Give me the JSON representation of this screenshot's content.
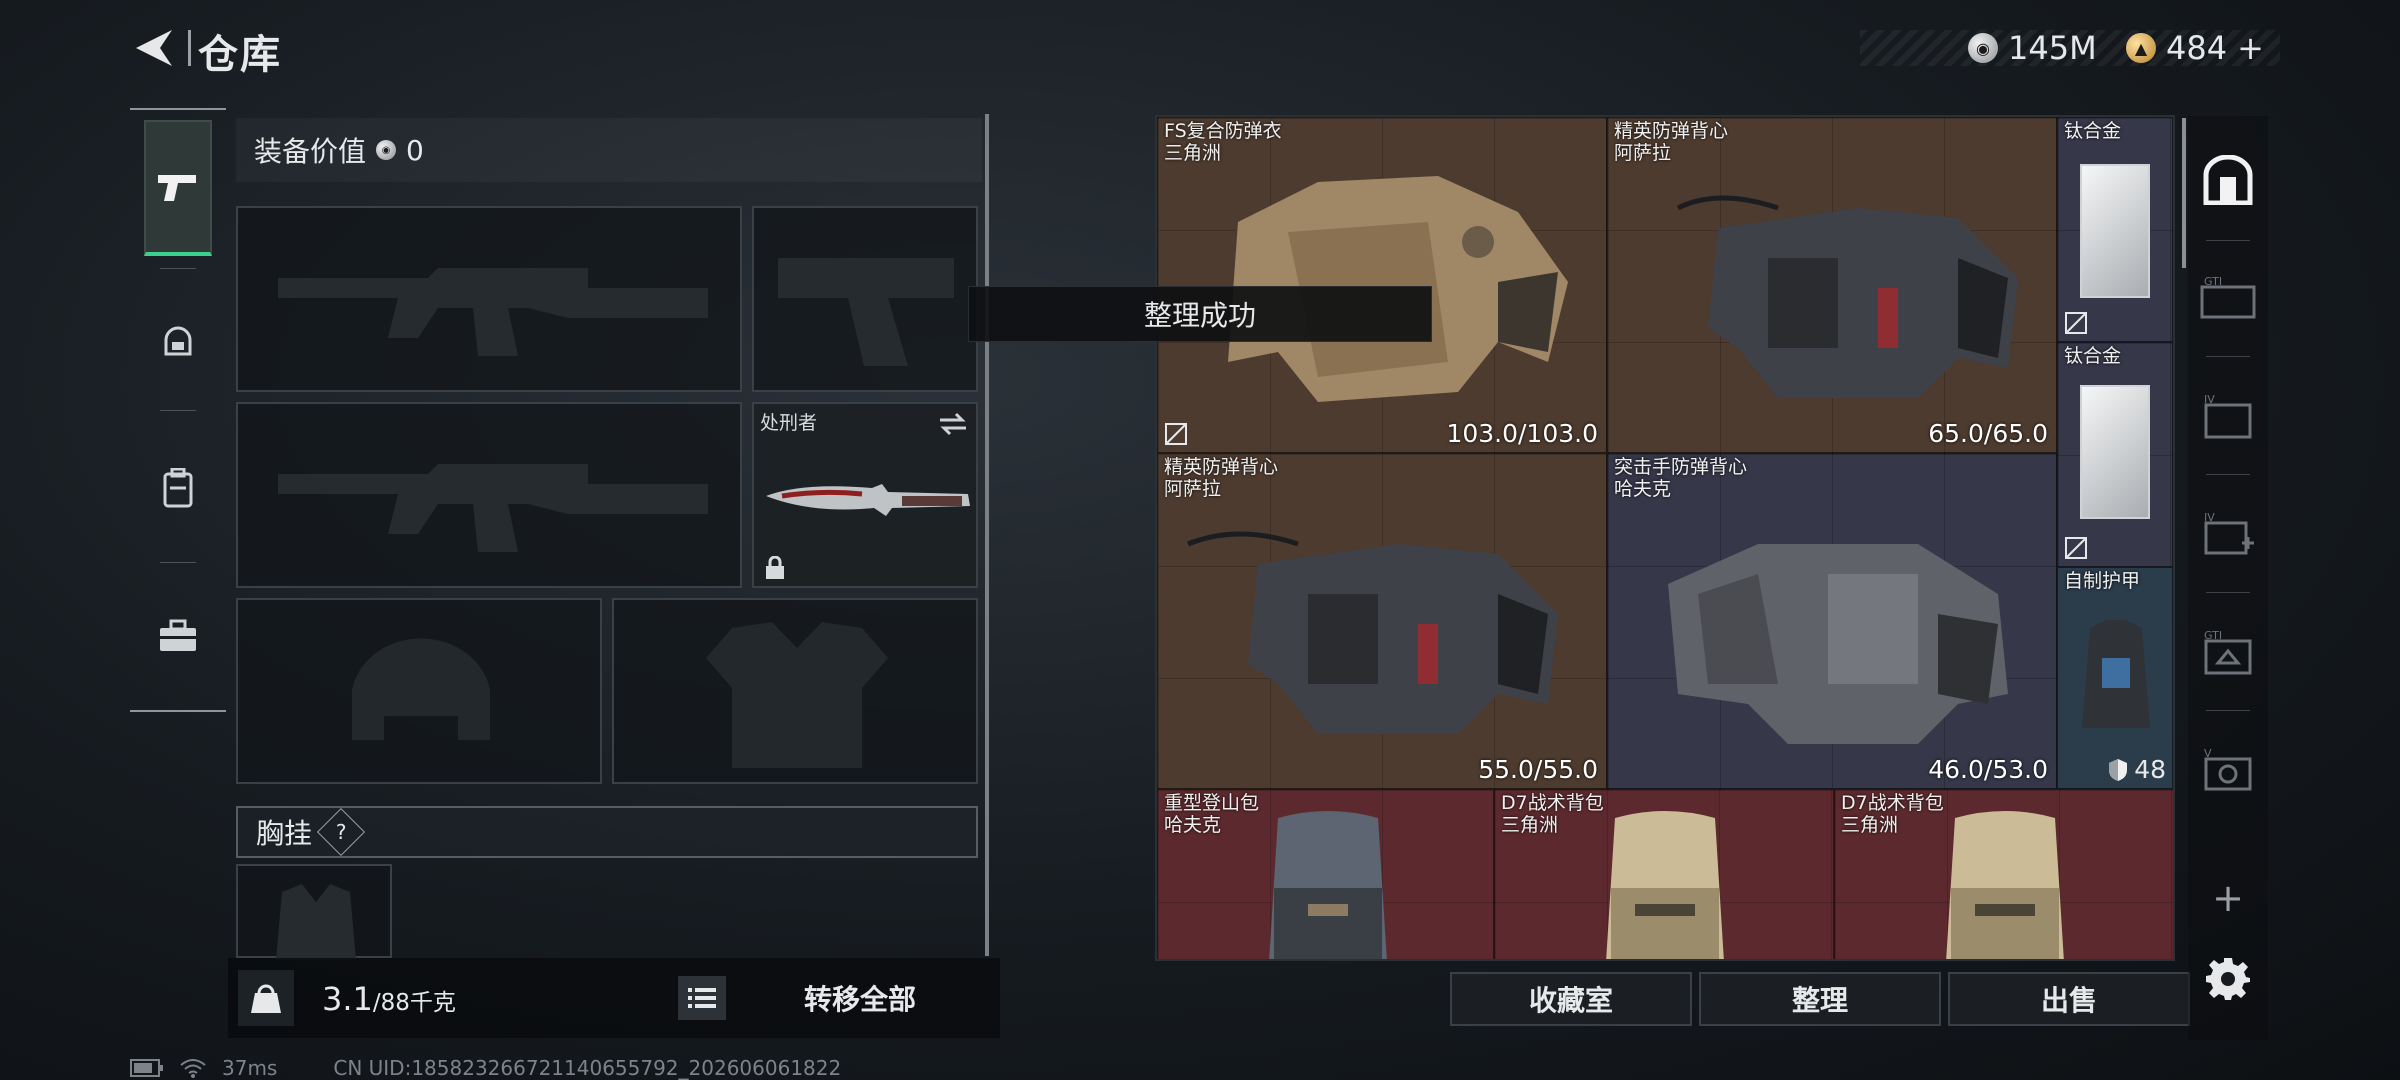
{
  "header": {
    "title": "仓库",
    "currency_silver": "145M",
    "currency_gold": "484",
    "gold_add": "+"
  },
  "equipment": {
    "value_label": "装备价值",
    "value": "0",
    "melee_name": "处刑者",
    "chest_label": "胸挂",
    "chest_help": "?",
    "weight_current": "3.1",
    "weight_max_unit": "/88千克",
    "transfer_all": "转移全部",
    "weight_icon_text": "KG"
  },
  "toast": {
    "text": "整理成功"
  },
  "storage": {
    "items": [
      {
        "name": "FS复合防弹衣",
        "origin": "三角洲",
        "durability": "103.0/103.0",
        "color": "#4d3b2f"
      },
      {
        "name": "精英防弹背心",
        "origin": "阿萨拉",
        "durability": "65.0/65.0",
        "color": "#4d3b2f"
      },
      {
        "name": "钛合金",
        "color": "#363749"
      },
      {
        "name": "钛合金",
        "color": "#363749"
      },
      {
        "name": "精英防弹背心",
        "origin": "阿萨拉",
        "durability": "55.0/55.0",
        "color": "#4d3b2f"
      },
      {
        "name": "突击手防弹背心",
        "origin": "哈夫克",
        "durability": "46.0/53.0",
        "color": "#363749"
      },
      {
        "name": "自制护甲",
        "armor_value": "48",
        "color": "#2b3c4b"
      },
      {
        "name": "重型登山包",
        "origin": "哈夫克",
        "color": "#5c2a2e"
      },
      {
        "name": "D7战术背包",
        "origin": "三角洲",
        "color": "#5c2a2e"
      },
      {
        "name": "D7战术背包",
        "origin": "三角洲",
        "color": "#5c2a2e"
      }
    ]
  },
  "buttons": {
    "collection": "收藏室",
    "sort": "整理",
    "sell": "出售"
  },
  "rail": {
    "labels": [
      "GTI",
      "IV",
      "IV",
      "GTI",
      "V"
    ],
    "add": "+"
  },
  "status": {
    "ping": "37ms",
    "uid": "CN UID:18582326672114065579​2_202606061822"
  },
  "icons": {
    "back": "back-arrow-icon",
    "silver": "silver-coin-icon",
    "gold": "gold-coin-icon",
    "tabs": [
      "pistol-icon",
      "helmet-icon",
      "backpack-icon",
      "toolbox-icon"
    ],
    "settings": "gear-icon"
  }
}
